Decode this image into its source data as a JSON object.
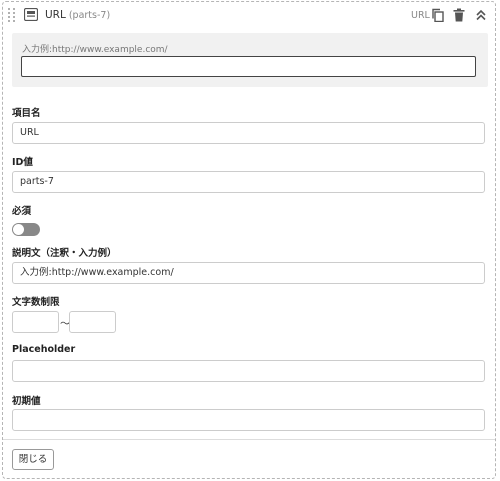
{
  "header": {
    "title": "URL",
    "part_id": "(parts-7)",
    "type_label": "URL",
    "icons": [
      "drag-handle-icon",
      "field-type-icon",
      "copy-icon",
      "trash-icon",
      "collapse-chevrons-icon"
    ]
  },
  "preview": {
    "hint": "入力例:http://www.example.com/",
    "value": ""
  },
  "fields": {
    "item_name": {
      "label": "項目名",
      "value": "URL"
    },
    "id_value": {
      "label": "ID値",
      "value": "parts-7"
    },
    "required": {
      "label": "必須",
      "on": false
    },
    "description": {
      "label": "説明文（注釈・入力例）",
      "value": "入力例:http://www.example.com/"
    },
    "char_limit": {
      "label": "文字数制限",
      "min": "",
      "separator": "〜",
      "max": ""
    },
    "placeholder": {
      "label": "Placeholder",
      "value": ""
    },
    "initial_value": {
      "label": "初期値",
      "value": ""
    }
  },
  "footer": {
    "close_label": "閉じる"
  }
}
